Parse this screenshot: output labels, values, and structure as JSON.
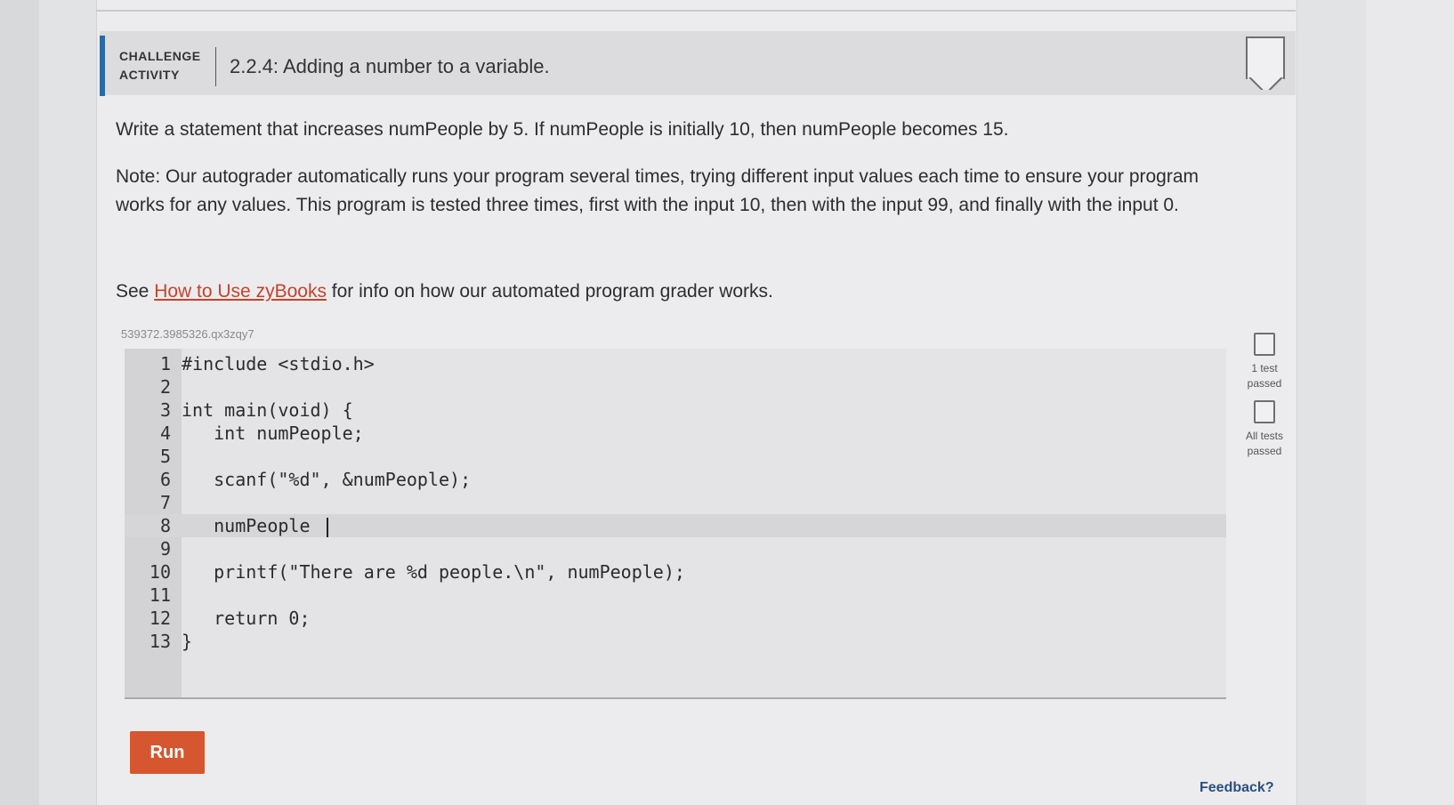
{
  "header": {
    "kind_label": "CHALLENGE ACTIVITY",
    "title": "2.2.4: Adding a number to a variable."
  },
  "instructions": {
    "paragraph1": "Write a statement that increases numPeople by 5. If numPeople is initially 10, then numPeople becomes 15.",
    "paragraph2": "Note: Our autograder automatically runs your program several times, trying different input values each time to ensure your program works for any values. This program is tested three times, first with the input 10, then with the input 99, and finally with the input 0.",
    "see_prefix": "See ",
    "link_text": "How to Use zyBooks",
    "see_suffix": " for info on how our automated program grader works."
  },
  "code": {
    "id": "539372.3985326.qx3zqy7",
    "lines": [
      {
        "n": "1",
        "text": "#include <stdio.h>"
      },
      {
        "n": "2",
        "text": ""
      },
      {
        "n": "3",
        "text": "int main(void) {"
      },
      {
        "n": "4",
        "text": "   int numPeople;"
      },
      {
        "n": "5",
        "text": ""
      },
      {
        "n": "6",
        "text": "   scanf(\"%d\", &numPeople);"
      },
      {
        "n": "7",
        "text": ""
      },
      {
        "n": "8",
        "text": "   numPeople "
      },
      {
        "n": "9",
        "text": ""
      },
      {
        "n": "10",
        "text": "   printf(\"There are %d people.\\n\", numPeople);"
      },
      {
        "n": "11",
        "text": ""
      },
      {
        "n": "12",
        "text": "   return 0;"
      },
      {
        "n": "13",
        "text": "}"
      }
    ]
  },
  "status": {
    "test1_label": "1 test passed",
    "test_all_label": "All tests passed"
  },
  "actions": {
    "run_label": "Run",
    "feedback_label": "Feedback?"
  },
  "colors": {
    "accent": "#2a6ba6",
    "run_button": "#d5562f",
    "link": "#c4432c"
  }
}
